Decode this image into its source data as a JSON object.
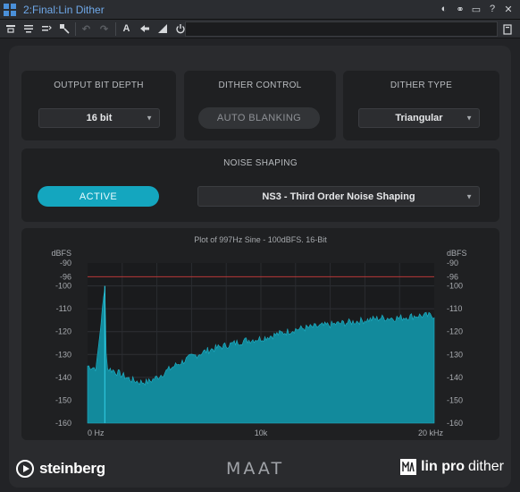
{
  "window": {
    "title": "2:Final:Lin Dither"
  },
  "toolbar": {
    "icons": [
      "compare-icon",
      "copy-settings-icon",
      "paste-settings-icon",
      "wrench-icon",
      "undo-icon",
      "redo-icon",
      "text-icon",
      "arrow-left-icon",
      "meter-icon",
      "power-icon"
    ],
    "text_tool": "A"
  },
  "output_bit_depth": {
    "label": "OUTPUT BIT DEPTH",
    "value": "16 bit"
  },
  "dither_control": {
    "label": "DITHER CONTROL",
    "button": "AUTO BLANKING"
  },
  "dither_type": {
    "label": "DITHER TYPE",
    "value": "Triangular"
  },
  "noise_shaping": {
    "label": "NOISE SHAPING",
    "active_button": "ACTIVE",
    "value": "NS3 - Third Order Noise Shaping"
  },
  "plot": {
    "title": "Plot of 997Hz Sine - 100dBFS. 16-Bit",
    "y_unit": "dBFS",
    "y_ticks": [
      "-90",
      "-96",
      "-100",
      "-110",
      "-120",
      "-130",
      "-140",
      "-150",
      "-160"
    ],
    "x_ticks": [
      "0 Hz",
      "10k",
      "20 kHz"
    ]
  },
  "chart_data": {
    "type": "area",
    "title": "Plot of 997Hz Sine - 100dBFS. 16-Bit",
    "xlabel": "",
    "ylabel": "dBFS",
    "xlim": [
      0,
      20000
    ],
    "ylim": [
      -160,
      -90
    ],
    "reference_line": -96,
    "x": [
      0,
      500,
      997,
      1100,
      1500,
      2000,
      2500,
      3000,
      3500,
      4000,
      5000,
      6000,
      7000,
      8000,
      9000,
      10000,
      11000,
      12000,
      13000,
      14000,
      15000,
      16000,
      17000,
      18000,
      19000,
      20000
    ],
    "values": [
      -135,
      -136,
      -100,
      -136,
      -137,
      -139,
      -141,
      -142,
      -142,
      -140,
      -135,
      -131,
      -128,
      -126,
      -124,
      -123,
      -121,
      -119,
      -118,
      -117,
      -116,
      -115,
      -114,
      -114,
      -113,
      -113
    ]
  },
  "footer": {
    "steinberg": "steinberg",
    "maat": "MAAT",
    "linpro_bold": "lin pro",
    "linpro_light": "dither",
    "linpro_icon": "MAAT"
  },
  "colors": {
    "accent": "#14a6bf",
    "plot_fill": "#128a9c",
    "reference_line": "#b83838"
  }
}
